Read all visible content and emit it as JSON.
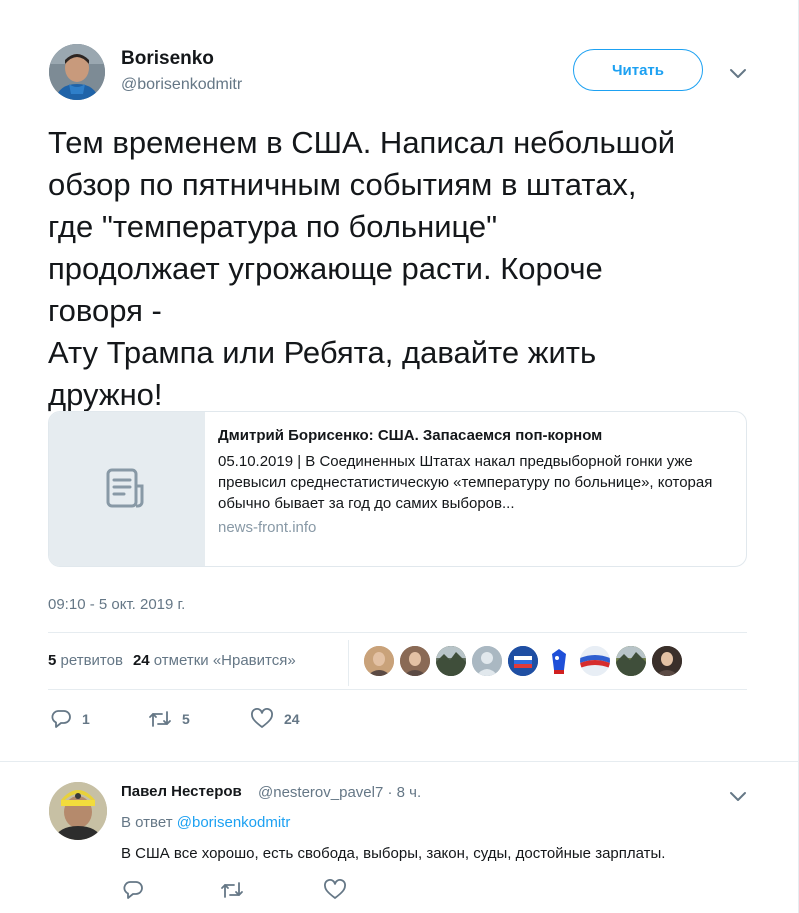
{
  "author": {
    "name": "Borisenko",
    "handle": "@borisenkodmitr",
    "follow_label": "Читать"
  },
  "tweet": {
    "text": "Тем временем в США. Написал небольшой\nобзор по пятничным событиям в штатах,\nгде \"температура по больнице\"\nпродолжает угрожающе расти. Короче\nговоря -\nАту Трампа или Ребята, давайте жить\nдружно!",
    "timestamp": "09:10 - 5 окт. 2019 г."
  },
  "card": {
    "title": "Дмитрий Борисенко: США. Запасаемся поп-корном",
    "description": "05.10.2019 | В Соединенных Штатах накал предвыборной гонки уже превысил среднестатистическую «температуру по больнице», которая обычно бывает за год до самих выборов...",
    "domain": "news-front.info",
    "thumb_icon": "document-icon"
  },
  "stats": {
    "retweets_count": "5",
    "retweets_label": "ретвитов",
    "likes_count": "24",
    "likes_label": "отметки «Нравится»",
    "likers": [
      {
        "icon": "avatar-woman-blonde",
        "color": "#c9a27a"
      },
      {
        "icon": "avatar-woman-dark",
        "color": "#8a6a55"
      },
      {
        "icon": "avatar-landscape",
        "color": "#5d6b5a"
      },
      {
        "icon": "avatar-default",
        "color": "#aab8c2"
      },
      {
        "icon": "avatar-flag-badge",
        "color": "#1f4fa3"
      },
      {
        "icon": "avatar-cartoon",
        "color": "#ffffff"
      },
      {
        "icon": "avatar-russian-flag",
        "color": "#e8eef5"
      },
      {
        "icon": "avatar-forest",
        "color": "#6e7d4b"
      },
      {
        "icon": "avatar-woman-portrait",
        "color": "#3a2f2a"
      }
    ]
  },
  "actions": {
    "reply_count": "1",
    "retweet_count": "5",
    "like_count": "24"
  },
  "reply": {
    "name": "Павел Нестеров",
    "meta": "@nesterov_pavel7 · 8 ч.",
    "in_reply_prefix": "В ответ",
    "in_reply_to": "@borisenkodmitr",
    "text": "В США все хорошо, есть свобода, выборы, закон, суды, достойные зарплаты."
  },
  "colors": {
    "accent": "#1da1f2",
    "secondary_text": "#657786",
    "border": "#e6ecf0"
  }
}
